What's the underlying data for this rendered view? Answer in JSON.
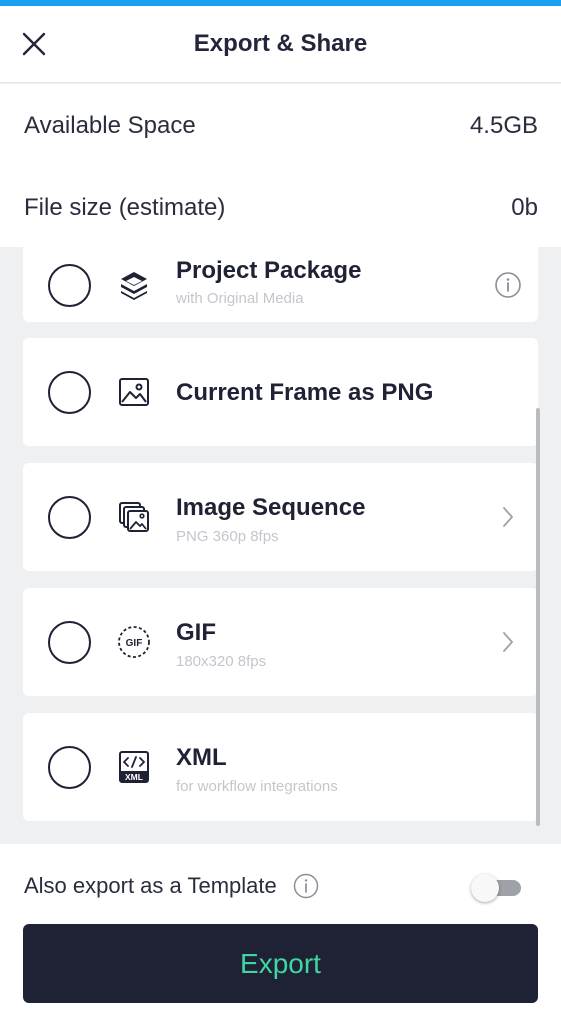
{
  "header": {
    "title": "Export & Share"
  },
  "info": {
    "available_space_label": "Available Space",
    "available_space_value": "4.5GB",
    "file_size_label": "File size (estimate)",
    "file_size_value": "0b"
  },
  "options": [
    {
      "title": "Project Package",
      "subtitle": "with Original Media",
      "icon": "layers-icon"
    },
    {
      "title": "Current Frame as PNG",
      "subtitle": "",
      "icon": "image-icon"
    },
    {
      "title": "Image Sequence",
      "subtitle": "PNG 360p 8fps",
      "icon": "image-stack-icon"
    },
    {
      "title": "GIF",
      "subtitle": "180x320 8fps",
      "icon": "gif-icon"
    },
    {
      "title": "XML",
      "subtitle": "for workflow integrations",
      "icon": "xml-code-icon"
    }
  ],
  "template": {
    "label": "Also export as a Template",
    "enabled": false
  },
  "export_button": {
    "label": "Export"
  },
  "colors": {
    "accent_bar": "#1aa0f0",
    "button_bg": "#1f2235",
    "button_text": "#3fd6a0"
  }
}
